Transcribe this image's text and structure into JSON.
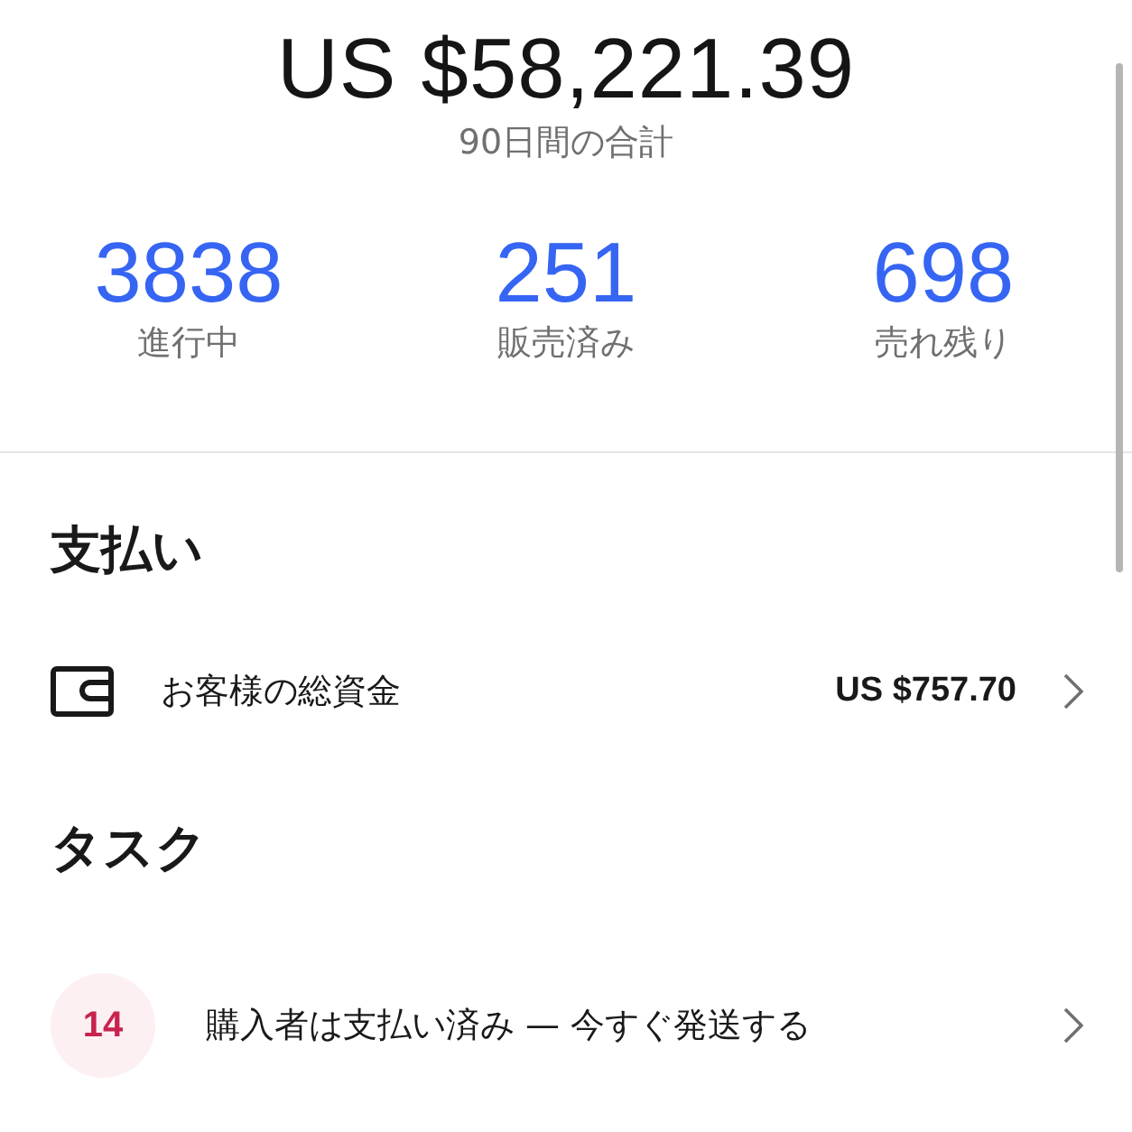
{
  "summary": {
    "total": "US $58,221.39",
    "caption": "90日間の合計"
  },
  "stats": [
    {
      "value": "3838",
      "label": "進行中"
    },
    {
      "value": "251",
      "label": "販売済み"
    },
    {
      "value": "698",
      "label": "売れ残り"
    }
  ],
  "payments": {
    "title": "支払い",
    "items": [
      {
        "label": "お客様の総資金",
        "amount": "US $757.70"
      }
    ]
  },
  "tasks": {
    "title": "タスク",
    "items": [
      {
        "count": "14",
        "label": "購入者は支払い済み — 今すぐ発送する"
      }
    ]
  }
}
